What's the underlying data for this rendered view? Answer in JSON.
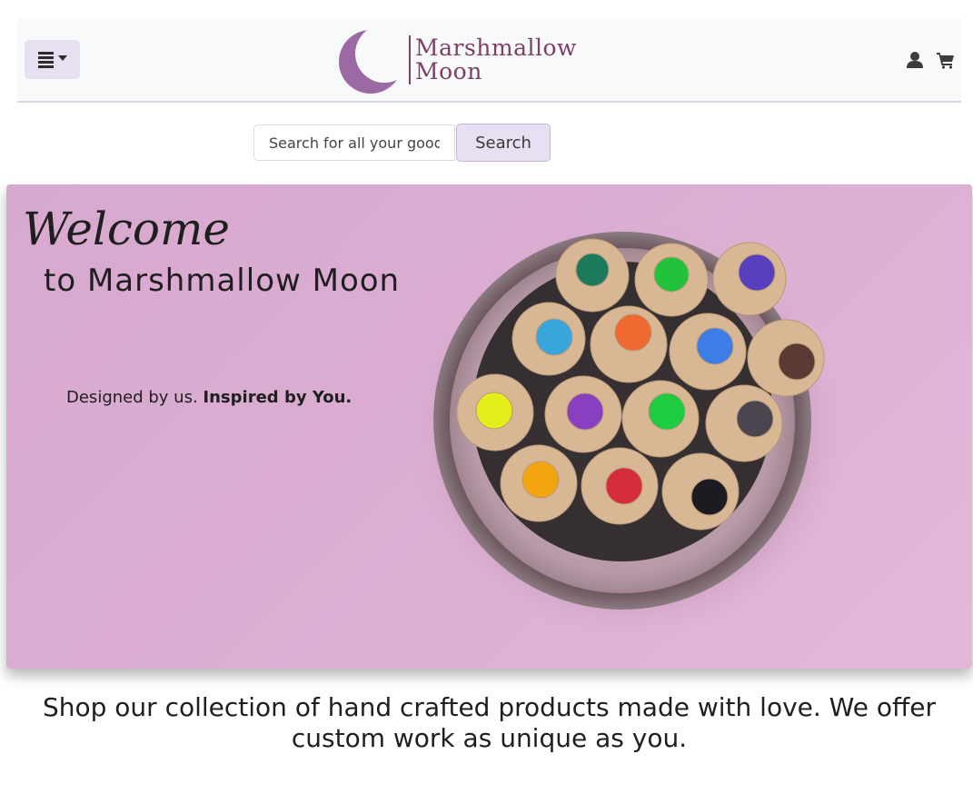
{
  "header": {
    "menu_toggle_icon": "hamburger-menu-icon",
    "logo": {
      "word_top": "Marshmallow",
      "word_bottom": "Moon",
      "icon": "crescent-moon-icon",
      "color": "#7d3f67",
      "moon_color": "#9b6aa4"
    },
    "account_icon": "user-icon",
    "cart_icon": "shopping-cart-icon"
  },
  "search": {
    "placeholder": "Search for all your goods",
    "button_label": "Search"
  },
  "hero": {
    "title": "Welcome",
    "subtitle": "to Marshmallow Moon",
    "tagline_regular": "Designed by us.",
    "tagline_bold": "Inspired by You.",
    "background_color": "#dcadd2"
  },
  "intro_text": "Shop our collection of hand crafted products made with love. We offer custom work as unique as you.",
  "colors": {
    "accent": "#e9dff2",
    "navbar_bg": "#f8f9fa",
    "brand": "#7d3f67"
  }
}
